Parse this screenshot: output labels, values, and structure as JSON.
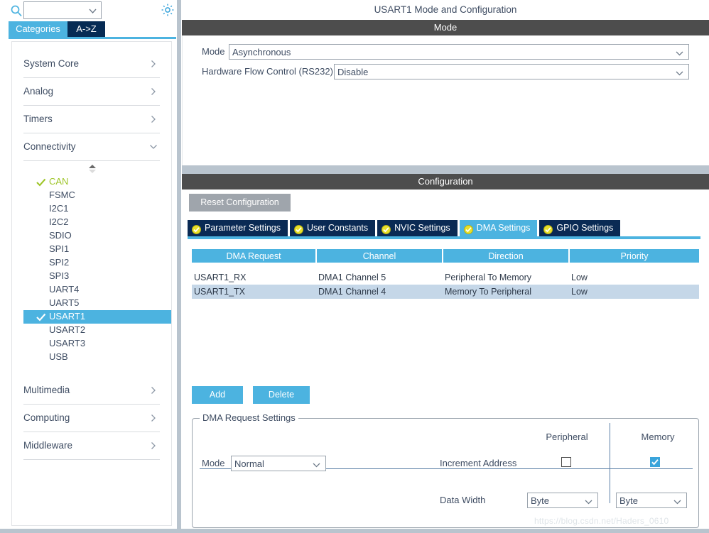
{
  "sidebar": {
    "search": {
      "value": "",
      "placeholder": "",
      "icon": "search-icon"
    },
    "gear_icon": "gear-icon",
    "tabs": [
      {
        "label": "Categories",
        "active": true
      },
      {
        "label": "A->Z",
        "active": false
      }
    ],
    "groups_top": [
      {
        "label": "System Core",
        "expanded": false,
        "arrow": "chevron-right-icon"
      },
      {
        "label": "Analog",
        "expanded": false,
        "arrow": "chevron-right-icon"
      },
      {
        "label": "Timers",
        "expanded": false,
        "arrow": "chevron-right-icon"
      },
      {
        "label": "Connectivity",
        "expanded": true,
        "arrow": "chevron-down-icon"
      }
    ],
    "peripherals": [
      {
        "label": "CAN",
        "state": "configured",
        "selected": false
      },
      {
        "label": "FSMC",
        "state": "none",
        "selected": false
      },
      {
        "label": "I2C1",
        "state": "none",
        "selected": false
      },
      {
        "label": "I2C2",
        "state": "none",
        "selected": false
      },
      {
        "label": "SDIO",
        "state": "none",
        "selected": false
      },
      {
        "label": "SPI1",
        "state": "none",
        "selected": false
      },
      {
        "label": "SPI2",
        "state": "none",
        "selected": false
      },
      {
        "label": "SPI3",
        "state": "none",
        "selected": false
      },
      {
        "label": "UART4",
        "state": "none",
        "selected": false
      },
      {
        "label": "UART5",
        "state": "none",
        "selected": false
      },
      {
        "label": "USART1",
        "state": "configured",
        "selected": true
      },
      {
        "label": "USART2",
        "state": "none",
        "selected": false
      },
      {
        "label": "USART3",
        "state": "none",
        "selected": false
      },
      {
        "label": "USB",
        "state": "none",
        "selected": false
      }
    ],
    "groups_bottom": [
      {
        "label": "Multimedia",
        "expanded": false,
        "arrow": "chevron-right-icon"
      },
      {
        "label": "Computing",
        "expanded": false,
        "arrow": "chevron-right-icon"
      },
      {
        "label": "Middleware",
        "expanded": false,
        "arrow": "chevron-right-icon"
      }
    ]
  },
  "main": {
    "title": "USART1 Mode and Configuration",
    "mode_section": {
      "header": "Mode",
      "fields": [
        {
          "label": "Mode",
          "value": "Asynchronous"
        },
        {
          "label": "Hardware Flow Control (RS232)",
          "value": "Disable"
        }
      ]
    },
    "configuration_section": {
      "header": "Configuration",
      "reset_button": "Reset Configuration",
      "tabs": [
        {
          "label": "Parameter Settings",
          "active": false,
          "badge": "check-badge-icon"
        },
        {
          "label": "User Constants",
          "active": false,
          "badge": "check-badge-icon"
        },
        {
          "label": "NVIC Settings",
          "active": false,
          "badge": "check-badge-icon"
        },
        {
          "label": "DMA Settings",
          "active": true,
          "badge": "check-badge-icon"
        },
        {
          "label": "GPIO Settings",
          "active": false,
          "badge": "check-badge-icon"
        }
      ],
      "dma_table": {
        "columns": [
          "DMA Request",
          "Channel",
          "Direction",
          "Priority"
        ],
        "rows": [
          {
            "cells": [
              "USART1_RX",
              "DMA1 Channel 5",
              "Peripheral To Memory",
              "Low"
            ],
            "selected": false
          },
          {
            "cells": [
              "USART1_TX",
              "DMA1 Channel 4",
              "Memory To Peripheral",
              "Low"
            ],
            "selected": true
          }
        ]
      },
      "add_button": "Add",
      "delete_button": "Delete",
      "request_settings": {
        "legend": "DMA Request Settings",
        "column_headers": {
          "peripheral": "Peripheral",
          "memory": "Memory"
        },
        "mode_label": "Mode",
        "mode_value": "Normal",
        "increment_address_label": "Increment Address",
        "increment_address_peripheral": false,
        "increment_address_memory": true,
        "data_width_label": "Data Width",
        "data_width_peripheral": "Byte",
        "data_width_memory": "Byte"
      }
    }
  },
  "watermark": "https://blog.csdn.net/Haders_0610",
  "colors": {
    "accent_blue": "#4cb3e0",
    "tab_navy": "#0a2a54",
    "header_gray": "#4d4d4d",
    "text_slate": "#3f4d63",
    "green_check": "#9ec528",
    "row_selected": "#c5d7e8",
    "splitter": "#b9c4ce"
  }
}
